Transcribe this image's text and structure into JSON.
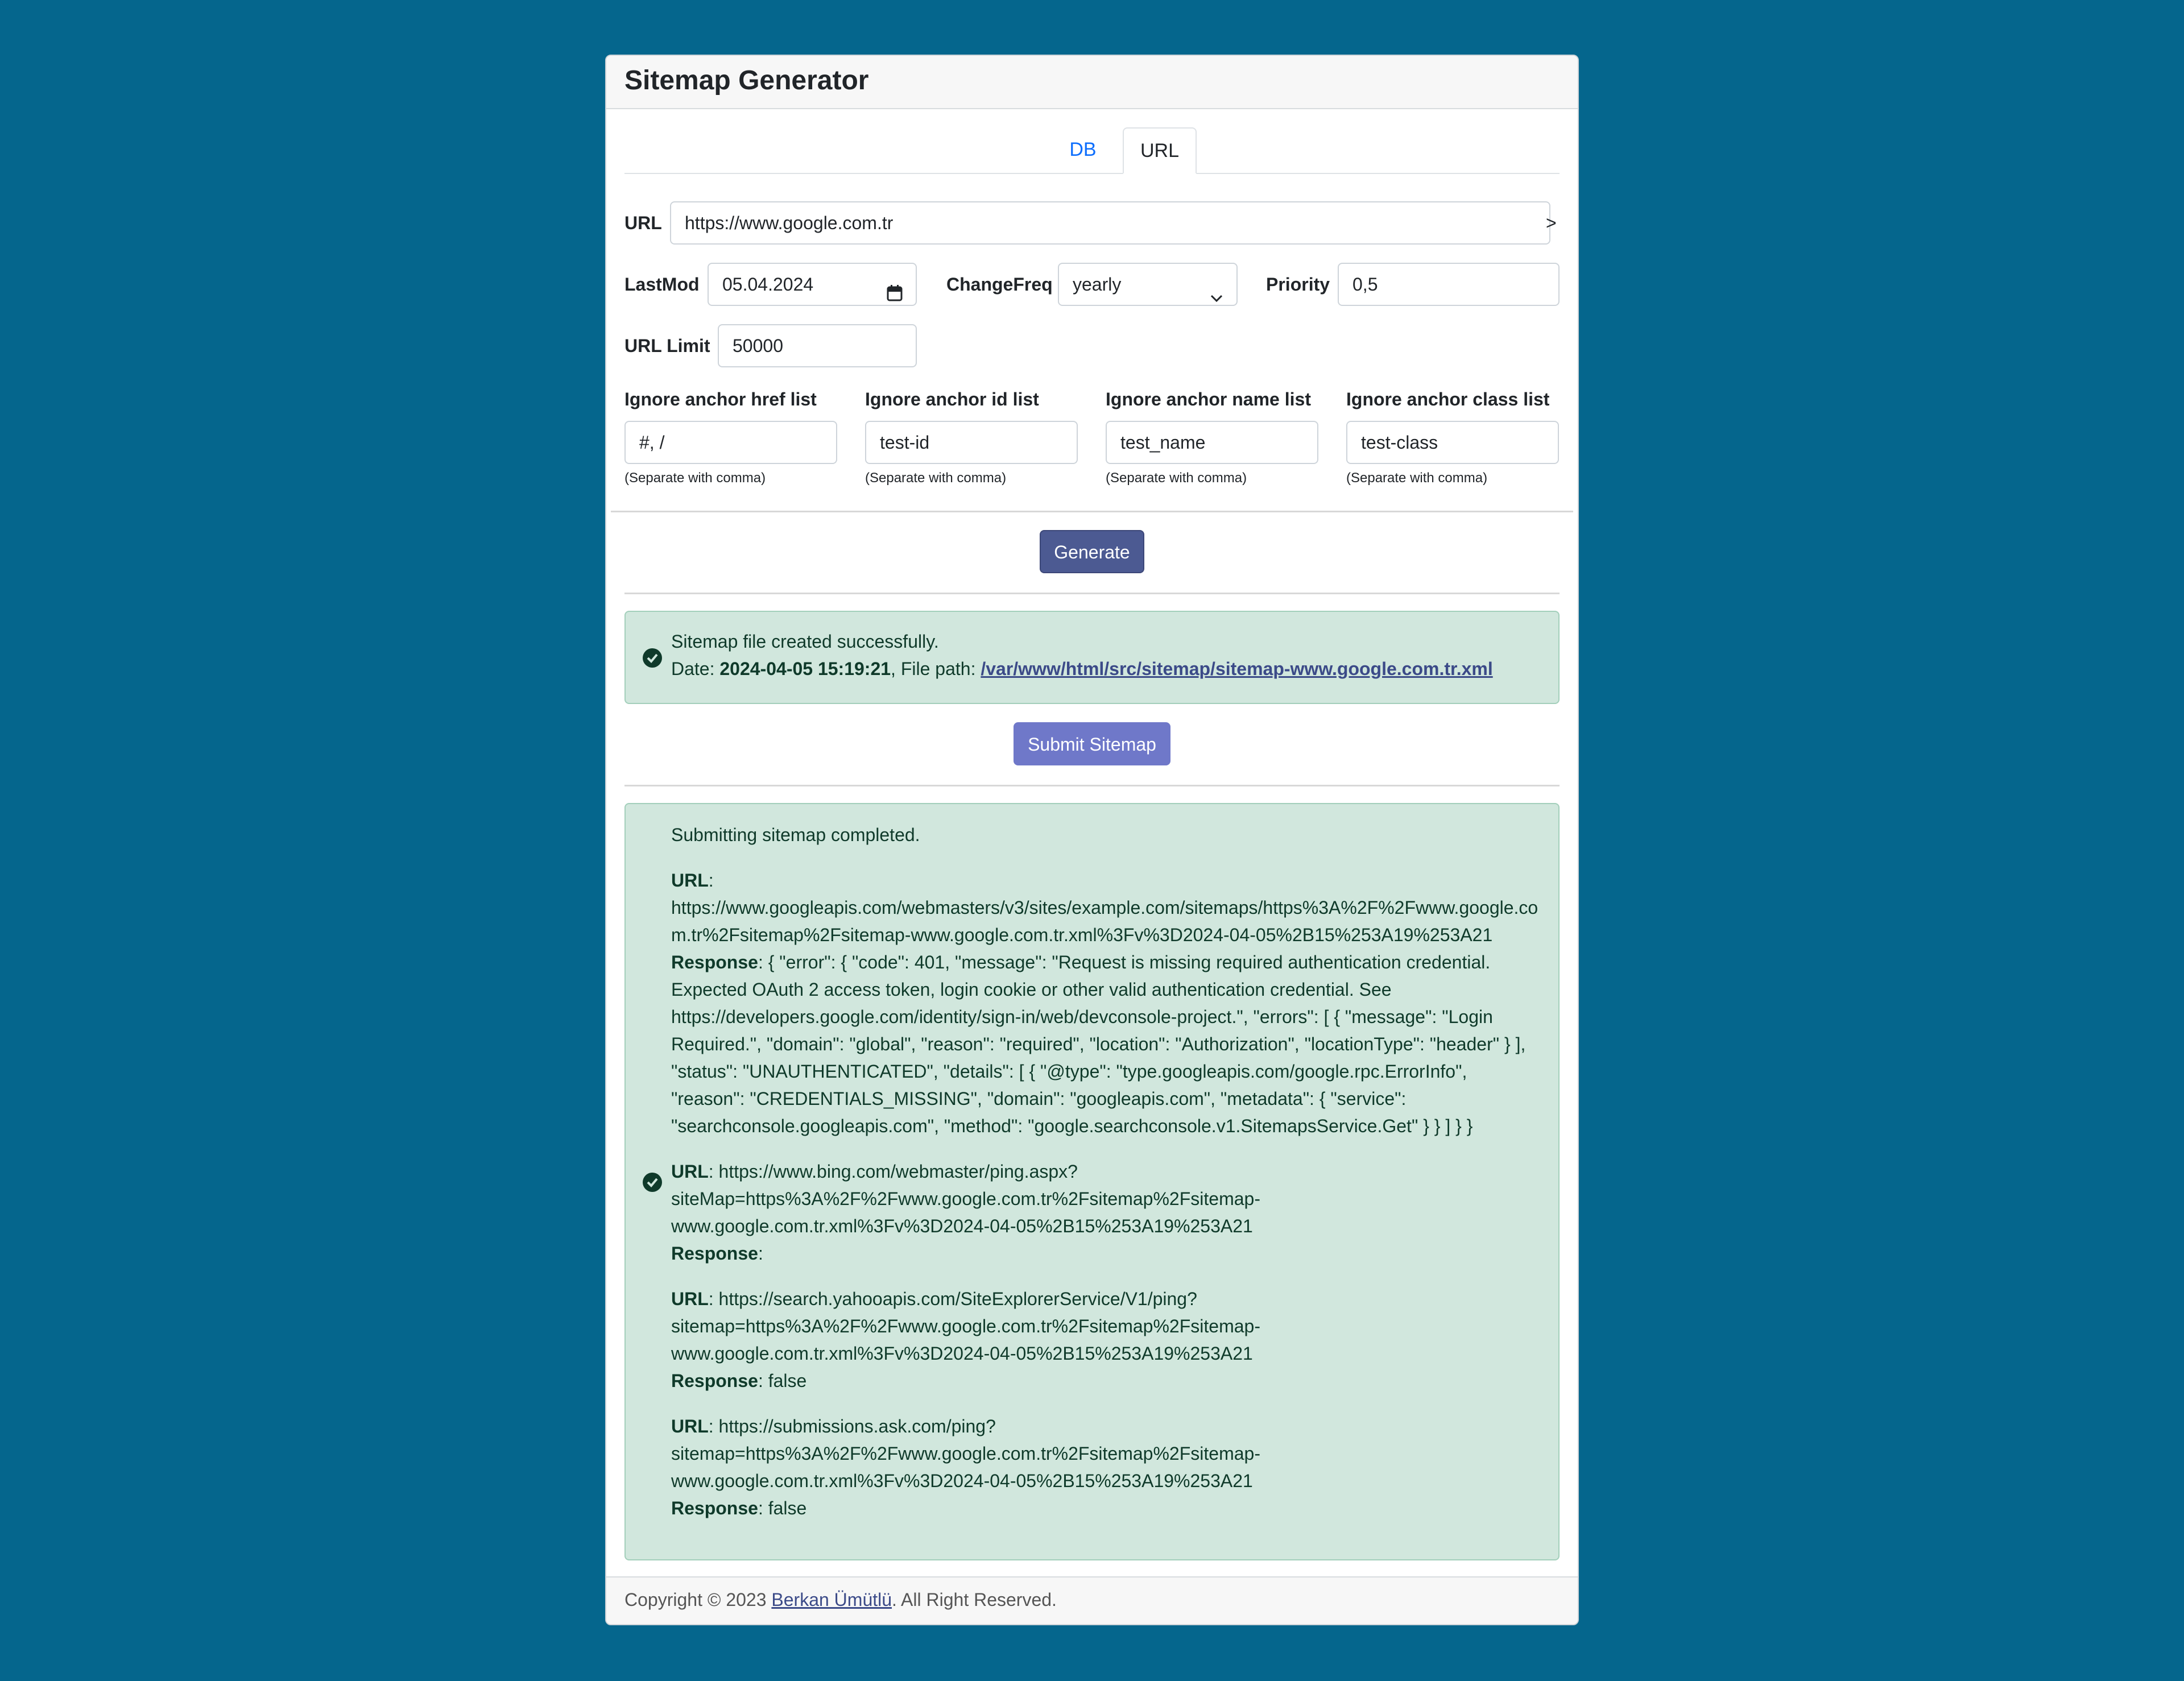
{
  "header": {
    "title": "Sitemap Generator"
  },
  "tabs": [
    {
      "label": "DB"
    },
    {
      "label": "URL"
    }
  ],
  "form": {
    "url_label": "URL",
    "url_value": "https://www.google.com.tr",
    "url_suffix": ">",
    "lastmod_label": "LastMod",
    "lastmod_value": "05.04.2024",
    "changefreq_label": "ChangeFreq",
    "changefreq_value": "yearly",
    "priority_label": "Priority",
    "priority_value": "0,5",
    "url_limit_label": "URL Limit",
    "url_limit_value": "50000",
    "ignore": [
      {
        "label": "Ignore anchor href list",
        "value": "#, /",
        "help": "(Separate with comma)"
      },
      {
        "label": "Ignore anchor id list",
        "value": "test-id",
        "help": "(Separate with comma)"
      },
      {
        "label": "Ignore anchor name list",
        "value": "test_name",
        "help": "(Separate with comma)"
      },
      {
        "label": "Ignore anchor class list",
        "value": "test-class",
        "help": "(Separate with comma)"
      }
    ]
  },
  "buttons": {
    "generate": "Generate",
    "submit": "Submit Sitemap"
  },
  "result": {
    "message": "Sitemap file created successfully.",
    "date_label": "Date: ",
    "date_value": "2024-04-05 15:19:21",
    "path_label": ", File path: ",
    "path_value": "/var/www/html/src/sitemap/sitemap-www.google.com.tr.xml"
  },
  "submission": {
    "title": "Submitting sitemap completed.",
    "url_key": "URL",
    "response_key": "Response",
    "google": {
      "url_lines": [
        "https://www.googleapis.com/webmasters/v3/sites/example.com/sitemaps/https%3A%2F%2Fwww.google.co",
        "m.tr%2Fsitemap%2Fsitemap-www.google.com.tr.xml%3Fv%3D2024-04-05%2B15%253A19%253A21"
      ],
      "response_first": ": { \"error\": { \"code\": 401, \"message\": \"Request is missing required authentication credential.",
      "response_lines": [
        "Expected OAuth 2 access token, login cookie or other valid authentication credential. See",
        "https://developers.google.com/identity/sign-in/web/devconsole-project.\", \"errors\": [ { \"message\": \"Login",
        "Required.\", \"domain\": \"global\", \"reason\": \"required\", \"location\": \"Authorization\", \"locationType\": \"header\" } ],",
        "\"status\": \"UNAUTHENTICATED\", \"details\": [ { \"@type\": \"type.googleapis.com/google.rpc.ErrorInfo\",",
        "\"reason\": \"CREDENTIALS_MISSING\", \"domain\": \"googleapis.com\", \"metadata\": { \"service\":",
        "\"searchconsole.googleapis.com\", \"method\": \"google.searchconsole.v1.SitemapsService.Get\" } } ] } }"
      ]
    },
    "bing": {
      "url_first": ": https://www.bing.com/webmaster/ping.aspx?",
      "url_lines": [
        "siteMap=https%3A%2F%2Fwww.google.com.tr%2Fsitemap%2Fsitemap-",
        "www.google.com.tr.xml%3Fv%3D2024-04-05%2B15%253A19%253A21"
      ],
      "response": ":"
    },
    "yahoo": {
      "url_first": ": https://search.yahooapis.com/SiteExplorerService/V1/ping?",
      "url_lines": [
        "sitemap=https%3A%2F%2Fwww.google.com.tr%2Fsitemap%2Fsitemap-",
        "www.google.com.tr.xml%3Fv%3D2024-04-05%2B15%253A19%253A21"
      ],
      "response": ": false"
    },
    "ask": {
      "url_first": ": https://submissions.ask.com/ping?",
      "url_lines": [
        "sitemap=https%3A%2F%2Fwww.google.com.tr%2Fsitemap%2Fsitemap-",
        "www.google.com.tr.xml%3Fv%3D2024-04-05%2B15%253A19%253A21"
      ],
      "response": ": false"
    }
  },
  "footer": {
    "prefix": "Copyright © 2023 ",
    "author": "Berkan Ümütlü",
    "suffix": ". All Right Reserved."
  },
  "colors": {
    "background": "#05668d",
    "generate_button": "#4c5a92",
    "submit_button": "#6f78c9",
    "alert_success": "#d1e7dd",
    "tab_link": "#0d6efd"
  },
  "icons": [
    "check-circle-icon",
    "calendar-icon",
    "chevron-down-icon"
  ]
}
